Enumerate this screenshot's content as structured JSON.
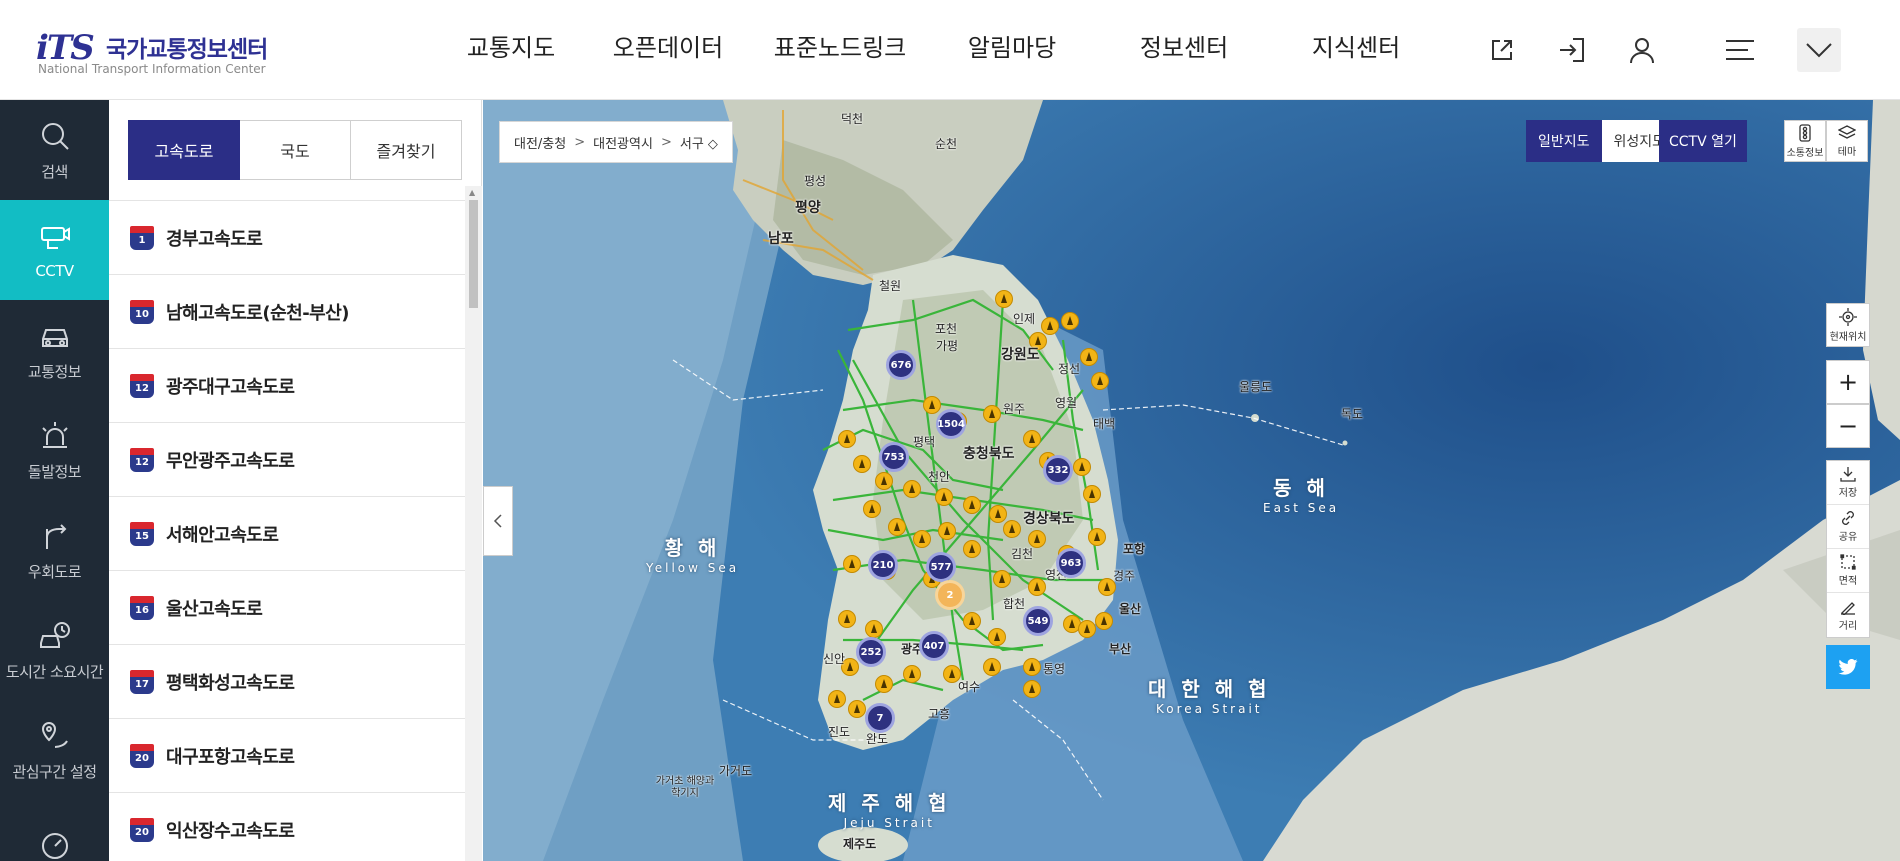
{
  "brand": {
    "logo_mark": "iTS",
    "name_ko": "국가교통정보센터",
    "name_en": "National Transport Information Center"
  },
  "gnb": [
    "교통지도",
    "오픈데이터",
    "표준노드링크",
    "알림마당",
    "정보센터",
    "지식센터"
  ],
  "header_icons": [
    "external-link-icon",
    "login-icon",
    "user-icon",
    "hamburger-menu-icon",
    "chevron-down-icon"
  ],
  "sidenav": [
    {
      "label": "검색",
      "icon": "search-icon",
      "active": false
    },
    {
      "label": "CCTV",
      "icon": "cctv-icon",
      "active": true
    },
    {
      "label": "교통정보",
      "icon": "car-icon",
      "active": false
    },
    {
      "label": "돌발정보",
      "icon": "alert-siren-icon",
      "active": false
    },
    {
      "label": "우회도로",
      "icon": "detour-icon",
      "active": false
    },
    {
      "label": "도시간 소요시간",
      "icon": "travel-time-icon",
      "active": false
    },
    {
      "label": "관심구간 설정",
      "icon": "favorite-section-icon",
      "active": false
    },
    {
      "label": "",
      "icon": "dashboard-icon",
      "active": false
    }
  ],
  "panel": {
    "tabs": [
      {
        "label": "고속도로",
        "active": true
      },
      {
        "label": "국도",
        "active": false
      },
      {
        "label": "즐겨찾기",
        "active": false
      }
    ],
    "roads": [
      {
        "num": "1",
        "name": "경부고속도로"
      },
      {
        "num": "10",
        "name": "남해고속도로(순천-부산)"
      },
      {
        "num": "12",
        "name": "광주대구고속도로"
      },
      {
        "num": "12",
        "name": "무안광주고속도로"
      },
      {
        "num": "15",
        "name": "서해안고속도로"
      },
      {
        "num": "16",
        "name": "울산고속도로"
      },
      {
        "num": "17",
        "name": "평택화성고속도로"
      },
      {
        "num": "20",
        "name": "대구포항고속도로"
      },
      {
        "num": "20",
        "name": "익산장수고속도로"
      }
    ]
  },
  "map": {
    "breadcrumb": [
      "대전/충청",
      "대전광역시",
      "서구 ◇"
    ],
    "map_types": [
      {
        "label": "일반지도",
        "active": true
      },
      {
        "label": "위성지도",
        "active": false
      }
    ],
    "cctv_open": "CCTV 열기",
    "top_buttons": [
      {
        "label": "소통정보",
        "icon": "traffic-light-icon"
      },
      {
        "label": "테마",
        "icon": "layers-icon"
      }
    ],
    "location_button": "현재위치",
    "zoom_in": "+",
    "zoom_out": "−",
    "tools": [
      {
        "label": "저장",
        "icon": "download-icon"
      },
      {
        "label": "공유",
        "icon": "link-icon"
      },
      {
        "label": "면적",
        "icon": "area-icon"
      },
      {
        "label": "거리",
        "icon": "ruler-icon"
      }
    ],
    "sea_labels": [
      {
        "ko": "황 해",
        "en": "Yellow Sea"
      },
      {
        "ko": "동 해",
        "en": "East Sea"
      },
      {
        "ko": "대 한 해 협",
        "en": "Korea Strait"
      },
      {
        "ko": "제 주 해 협",
        "en": "Jeju Strait"
      }
    ],
    "place_labels": [
      "덕천",
      "순천",
      "평성",
      "평양",
      "남포",
      "철원",
      "포천",
      "가평",
      "인제",
      "강원도",
      "원주",
      "영월",
      "평택",
      "천안",
      "충청북도",
      "경상북도",
      "김천",
      "영천",
      "경주",
      "합천",
      "포항",
      "울산",
      "부산",
      "광주",
      "신안",
      "고흥",
      "완도",
      "진도",
      "울릉도",
      "독도",
      "제주도",
      "가거도",
      "가거초 해양과학기지",
      "태백",
      "여수",
      "정선",
      "통영"
    ],
    "clusters": [
      "676",
      "1504",
      "753",
      "332",
      "210",
      "577",
      "963",
      "2",
      "549",
      "252",
      "407",
      "7"
    ]
  }
}
